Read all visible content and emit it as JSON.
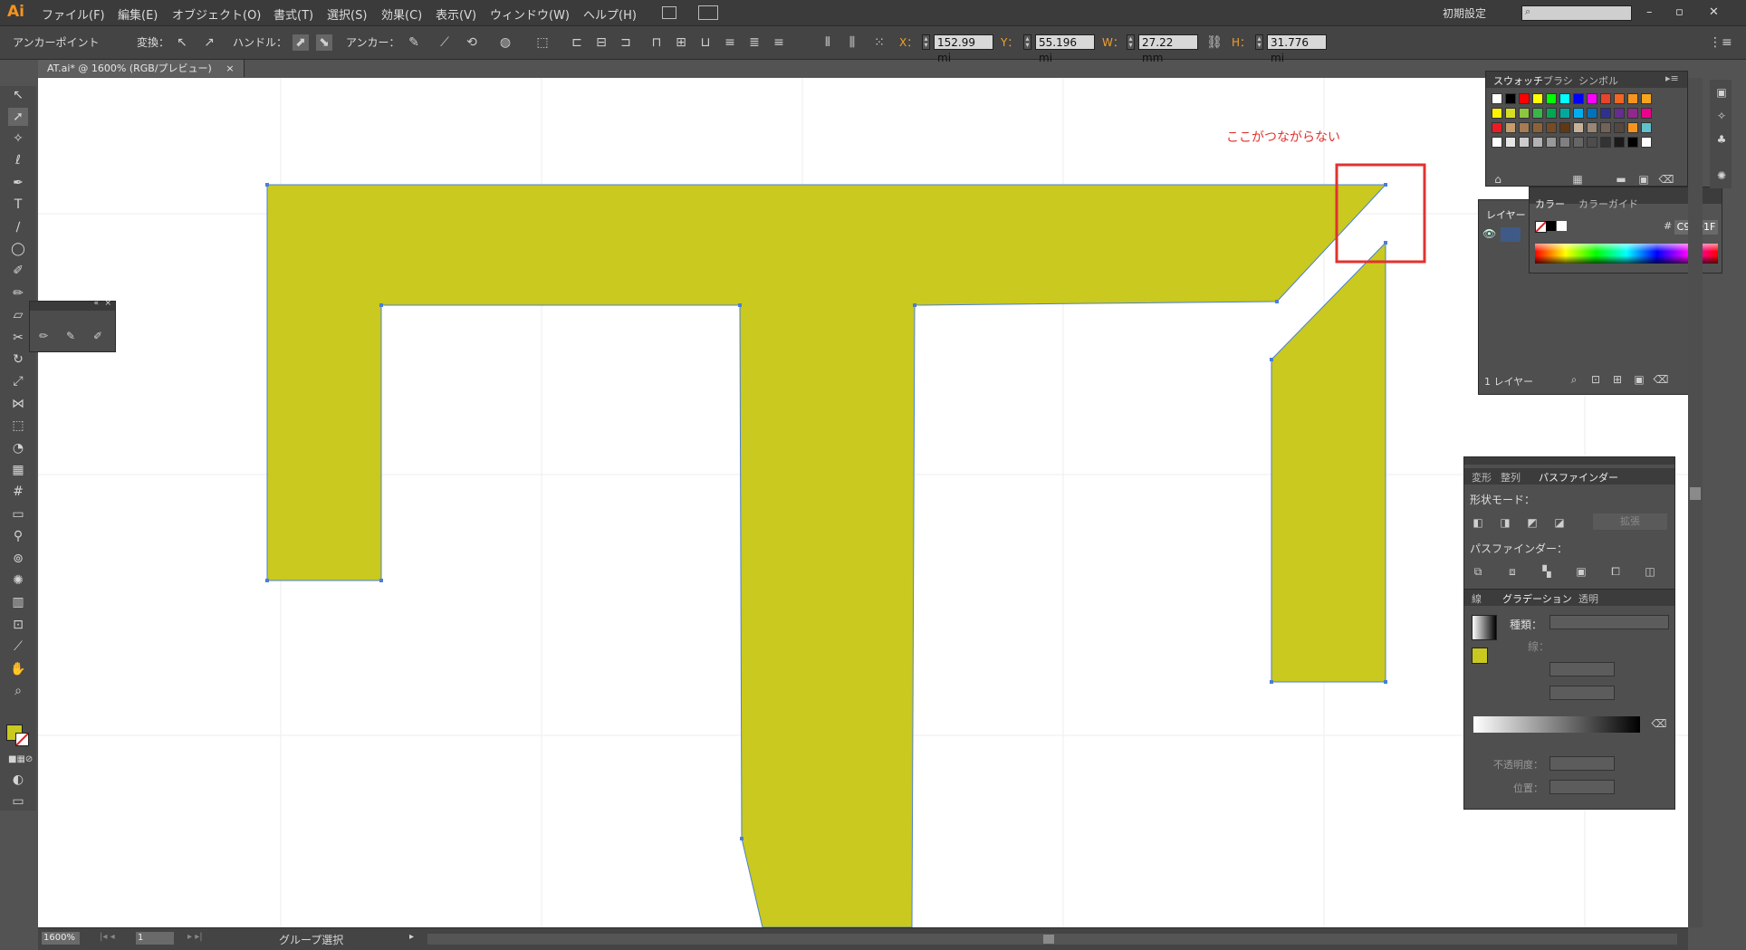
{
  "app": {
    "logo": "Ai",
    "workspace": "初期設定"
  },
  "menu": [
    "ファイル(F)",
    "編集(E)",
    "オブジェクト(O)",
    "書式(T)",
    "選択(S)",
    "効果(C)",
    "表示(V)",
    "ウィンドウ(W)",
    "ヘルプ(H)"
  ],
  "window_buttons": [
    "–",
    "▫",
    "✕"
  ],
  "control": {
    "mode_label": "アンカーポイント",
    "convert_label": "変換：",
    "handle_label": "ハンドル：",
    "anchor_label": "アンカー：",
    "x_label": "X：",
    "x_value": "152.99 mi",
    "y_label": "Y：",
    "y_value": "55.196 mi",
    "w_label": "W：",
    "w_value": "27.22 mm",
    "h_label": "H：",
    "h_value": "31.776 mi"
  },
  "document_tab": {
    "title": "AT.ai* @ 1600% (RGB/プレビュー)",
    "close": "×"
  },
  "annotation": {
    "text": "ここがつながらない",
    "color": "#e0332f"
  },
  "shape_fill": "#C9C91F",
  "swatches_panel": {
    "tabs": [
      "スウォッチ",
      "ブラシ",
      "シンボル"
    ],
    "rows": [
      [
        "#ffffff",
        "#000000",
        "#ff0000",
        "#ffff00",
        "#00ff00",
        "#00ffff",
        "#0000ff",
        "#ff00ff",
        "#e8432b",
        "#f26522",
        "#f7941d",
        "#f9a51b"
      ],
      [
        "#fff200",
        "#d7df23",
        "#8dc63f",
        "#39b54a",
        "#00a651",
        "#00a99d",
        "#00aeef",
        "#0072bc",
        "#2e3192",
        "#662d91",
        "#92278f",
        "#ec008c"
      ],
      [
        "#ed1c24",
        "#c69c6d",
        "#a67c52",
        "#8c6239",
        "#754c24",
        "#603913",
        "#c7b299",
        "#998675",
        "#736357",
        "#534741",
        "#f7941d",
        "#62c2cc"
      ],
      [
        "#ffffff",
        "#e6e6e6",
        "#cccccc",
        "#b3b3b3",
        "#999999",
        "#808080",
        "#666666",
        "#4d4d4d",
        "#333333",
        "#1a1a1a",
        "#000000",
        "#ffffff"
      ]
    ]
  },
  "layers_panel": {
    "tab": "レイヤー",
    "count_label": "1 レイヤー"
  },
  "color_panel": {
    "tabs": [
      "カラー",
      "カラーガイド"
    ],
    "hash": "#",
    "hex": "C9C91F"
  },
  "pathfinder_panel": {
    "tabs": [
      "変形",
      "整列",
      "パスファインダー"
    ],
    "shape_mode": "形状モード：",
    "expand": "拡張",
    "pathfinder": "パスファインダー："
  },
  "gradient_panel": {
    "tabs": [
      "線",
      "グラデーション",
      "透明"
    ],
    "type_label": "種類：",
    "stroke_label": "線：",
    "opacity_label": "不透明度：",
    "position_label": "位置："
  },
  "status": {
    "zoom": "1600%",
    "artboard": "1",
    "tool": "グループ選択"
  }
}
